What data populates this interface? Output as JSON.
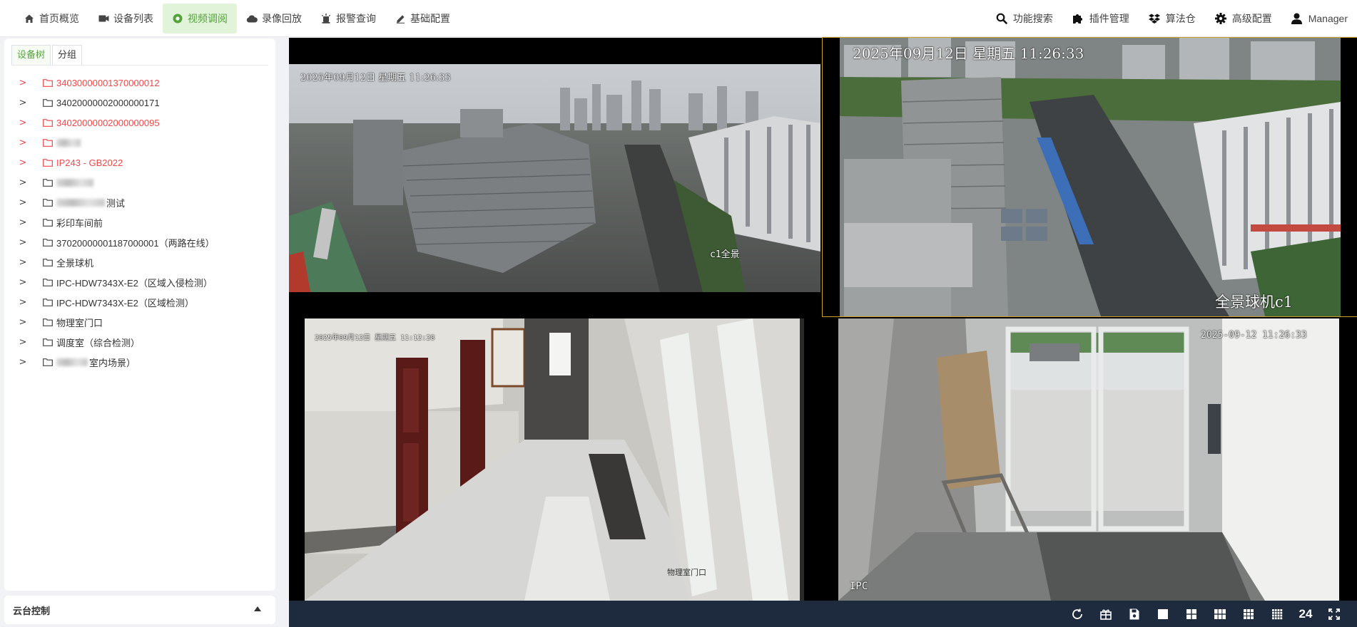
{
  "nav": {
    "left": [
      {
        "label": "首页概览",
        "icon": "home-icon"
      },
      {
        "label": "设备列表",
        "icon": "camera-icon"
      },
      {
        "label": "视频调阅",
        "icon": "play-circle-icon",
        "active": true
      },
      {
        "label": "录像回放",
        "icon": "cloud-icon"
      },
      {
        "label": "报警查询",
        "icon": "alarm-icon"
      },
      {
        "label": "基础配置",
        "icon": "pencil-icon"
      }
    ],
    "right": [
      {
        "label": "功能搜索",
        "icon": "search-icon"
      },
      {
        "label": "插件管理",
        "icon": "puzzle-icon"
      },
      {
        "label": "算法仓",
        "icon": "dropbox-icon"
      },
      {
        "label": "高级配置",
        "icon": "gear-icon"
      },
      {
        "label": "Manager",
        "icon": "user-icon"
      }
    ]
  },
  "left_panel": {
    "tabs": [
      "设备树",
      "分组"
    ],
    "active_tab": "设备树",
    "tree": [
      {
        "label": "34030000001370000012",
        "status": "offline"
      },
      {
        "label": "34020000002000000171",
        "status": "online"
      },
      {
        "label": "34020000002000000095",
        "status": "offline"
      },
      {
        "label": "",
        "status": "offline",
        "redacted": true
      },
      {
        "label": "IP243 - GB2022",
        "status": "offline"
      },
      {
        "label": "",
        "status": "online",
        "redacted": true
      },
      {
        "label": "测试",
        "status": "online",
        "redacted_prefix": true
      },
      {
        "label": "彩印车间前",
        "status": "online"
      },
      {
        "label": "37020000001187000001（两路在线）",
        "status": "online"
      },
      {
        "label": "全景球机",
        "status": "online"
      },
      {
        "label": "IPC-HDW7343X-E2（区域入侵检测）",
        "status": "online"
      },
      {
        "label": "IPC-HDW7343X-E2（区域检测）",
        "status": "online"
      },
      {
        "label": "物理室门口",
        "status": "online"
      },
      {
        "label": "调度室（综合检测）",
        "status": "online"
      },
      {
        "label": "室内场景）",
        "status": "online",
        "redacted_prefix": true
      }
    ],
    "ptz_label": "云台控制"
  },
  "videos": [
    {
      "osd_time": "2025年09月12日  星期五  11:26:33",
      "osd_label": "c1全景"
    },
    {
      "osd_time": "2025年09月12日  星期五  11:26:33",
      "osd_label": "全景球机c1"
    },
    {
      "osd_time": "2025年09月12日  星期五  11:12:28",
      "osd_label": "物理室门口"
    },
    {
      "osd_time": "2025-09-12 11:26:33",
      "osd_label": "IPC"
    }
  ],
  "bottom_bar": {
    "tools": [
      "refresh-icon",
      "gift-icon",
      "save-icon",
      "layout-1-icon",
      "layout-4-icon",
      "layout-6-icon",
      "layout-9-icon",
      "layout-16-icon"
    ],
    "window_count": "24"
  },
  "colors": {
    "accent": "#52a43a",
    "active_bg": "#e1f3d8",
    "offline": "#f04848",
    "bottom_bar": "#1e2a3d"
  }
}
